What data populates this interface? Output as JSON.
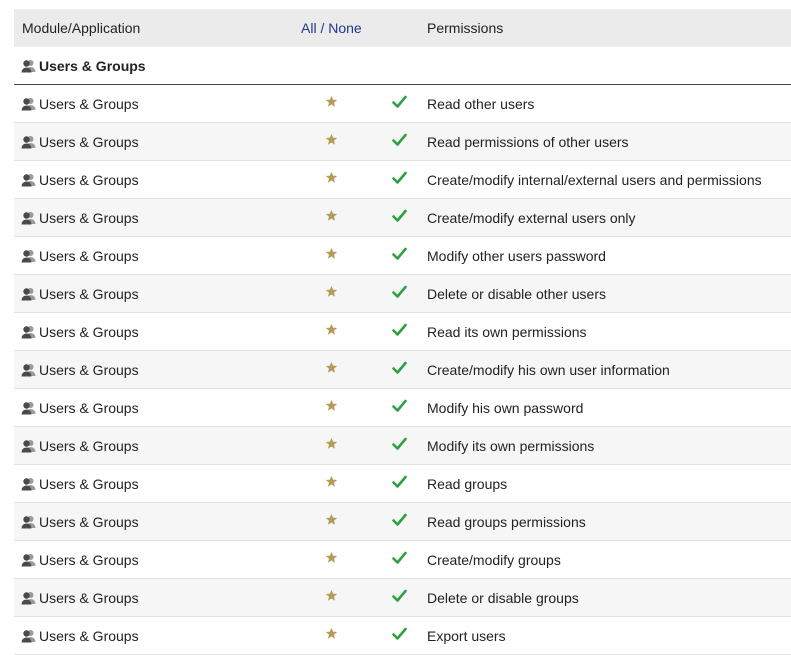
{
  "header": {
    "module_label": "Module/Application",
    "all_label": "All",
    "separator": "/",
    "none_label": "None",
    "permissions_label": "Permissions"
  },
  "group": {
    "name": "Users & Groups",
    "icon": "users-icon"
  },
  "rows": [
    {
      "module": "Users & Groups",
      "permission": "Read other users"
    },
    {
      "module": "Users & Groups",
      "permission": "Read permissions of other users"
    },
    {
      "module": "Users & Groups",
      "permission": "Create/modify internal/external users and permissions"
    },
    {
      "module": "Users & Groups",
      "permission": "Create/modify external users only"
    },
    {
      "module": "Users & Groups",
      "permission": "Modify other users password"
    },
    {
      "module": "Users & Groups",
      "permission": "Delete or disable other users"
    },
    {
      "module": "Users & Groups",
      "permission": "Read its own permissions"
    },
    {
      "module": "Users & Groups",
      "permission": "Create/modify his own user information"
    },
    {
      "module": "Users & Groups",
      "permission": "Modify his own password"
    },
    {
      "module": "Users & Groups",
      "permission": "Modify its own permissions"
    },
    {
      "module": "Users & Groups",
      "permission": "Read groups"
    },
    {
      "module": "Users & Groups",
      "permission": "Read groups permissions"
    },
    {
      "module": "Users & Groups",
      "permission": "Create/modify groups"
    },
    {
      "module": "Users & Groups",
      "permission": "Delete or disable groups"
    },
    {
      "module": "Users & Groups",
      "permission": "Export users"
    }
  ],
  "colors": {
    "header_bg": "#ebebeb",
    "link": "#1f3a8a",
    "star": "#b39b5a",
    "check": "#2ea043",
    "alt_row": "#f6f6f6"
  },
  "icons": {
    "module": "users-icon",
    "default": "star-icon",
    "granted": "checkmark-icon"
  }
}
